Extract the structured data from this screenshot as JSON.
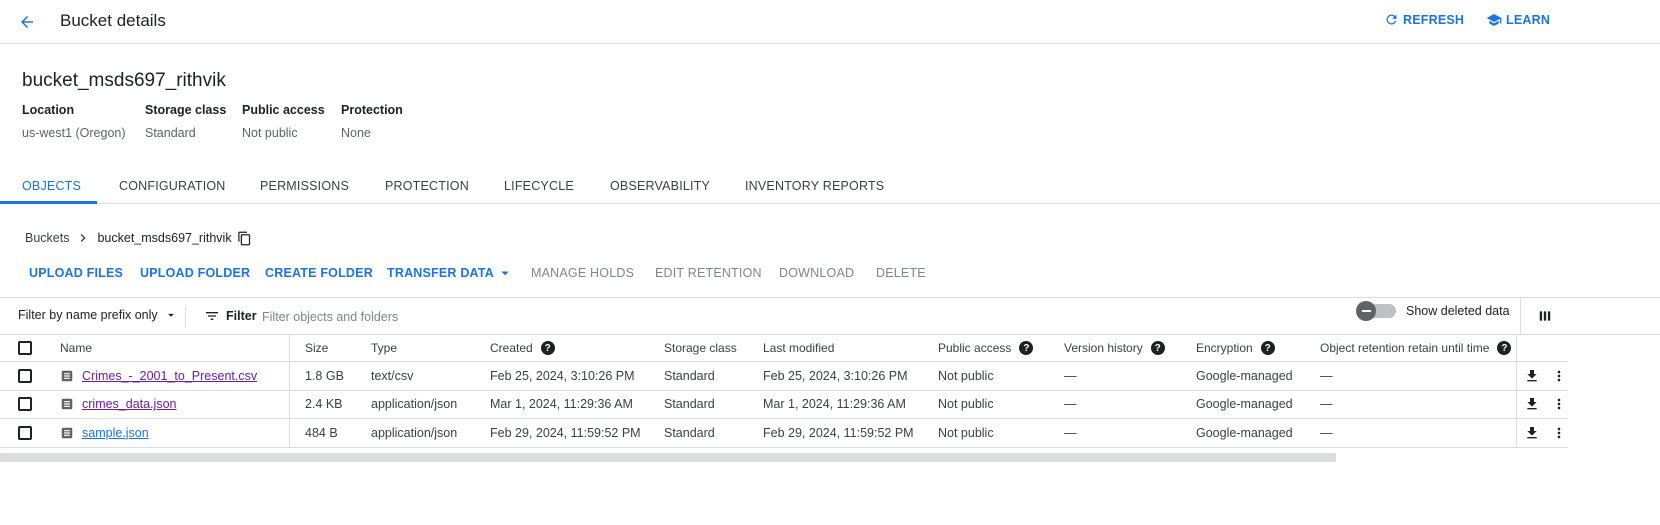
{
  "header": {
    "title": "Bucket details",
    "refresh_label": "REFRESH",
    "learn_label": "LEARN"
  },
  "bucket": {
    "name": "bucket_msds697_rithvik",
    "meta": [
      {
        "label": "Location",
        "value": "us-west1 (Oregon)"
      },
      {
        "label": "Storage class",
        "value": "Standard"
      },
      {
        "label": "Public access",
        "value": "Not public"
      },
      {
        "label": "Protection",
        "value": "None"
      }
    ]
  },
  "tabs": [
    "OBJECTS",
    "CONFIGURATION",
    "PERMISSIONS",
    "PROTECTION",
    "LIFECYCLE",
    "OBSERVABILITY",
    "INVENTORY REPORTS"
  ],
  "breadcrumb": {
    "root": "Buckets",
    "current": "bucket_msds697_rithvik"
  },
  "actions": {
    "upload_files": "UPLOAD FILES",
    "upload_folder": "UPLOAD FOLDER",
    "create_folder": "CREATE FOLDER",
    "transfer_data": "TRANSFER DATA",
    "manage_holds": "MANAGE HOLDS",
    "edit_retention": "EDIT RETENTION",
    "download": "DOWNLOAD",
    "delete": "DELETE"
  },
  "filter": {
    "prefix_label": "Filter by name prefix only",
    "filter_label": "Filter",
    "placeholder": "Filter objects and folders",
    "show_deleted_label": "Show deleted data"
  },
  "table": {
    "columns": {
      "name": "Name",
      "size": "Size",
      "type": "Type",
      "created": "Created",
      "storage_class": "Storage class",
      "last_modified": "Last modified",
      "public_access": "Public access",
      "version_history": "Version history",
      "encryption": "Encryption",
      "retention": "Object retention retain until time"
    },
    "rows": [
      {
        "name": "Crimes_-_2001_to_Present.csv",
        "size": "1.8 GB",
        "type": "text/csv",
        "created": "Feb 25, 2024, 3:10:26 PM",
        "storage_class": "Standard",
        "last_modified": "Feb 25, 2024, 3:10:26 PM",
        "public_access": "Not public",
        "version_history": "—",
        "encryption": "Google-managed",
        "retention": "—"
      },
      {
        "name": "crimes_data.json",
        "size": "2.4 KB",
        "type": "application/json",
        "created": "Mar 1, 2024, 11:29:36 AM",
        "storage_class": "Standard",
        "last_modified": "Mar 1, 2024, 11:29:36 AM",
        "public_access": "Not public",
        "version_history": "—",
        "encryption": "Google-managed",
        "retention": "—"
      },
      {
        "name": "sample.json",
        "size": "484 B",
        "type": "application/json",
        "created": "Feb 29, 2024, 11:59:52 PM",
        "storage_class": "Standard",
        "last_modified": "Feb 29, 2024, 11:59:52 PM",
        "public_access": "Not public",
        "version_history": "—",
        "encryption": "Google-managed",
        "retention": "—"
      }
    ]
  },
  "colors": {
    "accent": "#1a73e8",
    "visited_link": "#681da8",
    "border": "#dadce0"
  }
}
